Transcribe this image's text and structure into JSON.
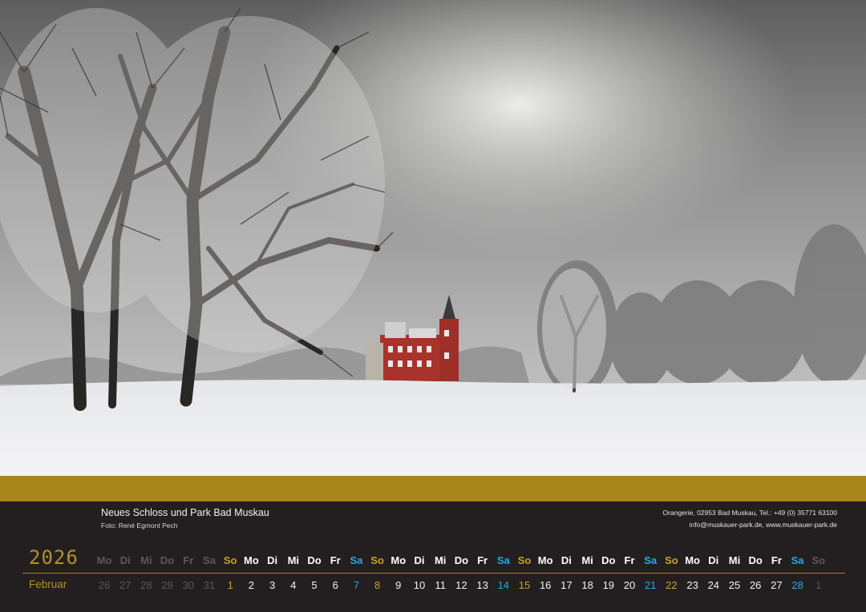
{
  "caption": {
    "title": "Neues Schloss und Park Bad Muskau",
    "credit": "Foto: René Egmont Pech"
  },
  "contact": {
    "line1": "Orangerie, 02953 Bad Muskau, Tel.: +49 (0) 35771 63100",
    "line2": "info@muskauer-park.de, www.muskauer-park.de"
  },
  "calendar": {
    "year": "2026",
    "month": "Februar",
    "weekdays": [
      "Mo",
      "Di",
      "Mi",
      "Do",
      "Fr",
      "Sa",
      "So",
      "Mo",
      "Di",
      "Mi",
      "Do",
      "Fr",
      "Sa",
      "So",
      "Mo",
      "Di",
      "Mi",
      "Do",
      "Fr",
      "Sa",
      "So",
      "Mo",
      "Di",
      "Mi",
      "Do",
      "Fr",
      "Sa",
      "So",
      "Mo",
      "Di",
      "Mi",
      "Do",
      "Fr",
      "Sa",
      "So"
    ],
    "dates": [
      "26",
      "27",
      "28",
      "29",
      "30",
      "31",
      "1",
      "2",
      "3",
      "4",
      "5",
      "6",
      "7",
      "8",
      "9",
      "10",
      "11",
      "12",
      "13",
      "14",
      "15",
      "16",
      "17",
      "18",
      "19",
      "20",
      "21",
      "22",
      "23",
      "24",
      "25",
      "26",
      "27",
      "28",
      "1"
    ],
    "styles": [
      "mute",
      "mute",
      "mute",
      "mute",
      "mute",
      "mute",
      "gold",
      "white",
      "white",
      "white",
      "white",
      "white",
      "blue",
      "gold",
      "white",
      "white",
      "white",
      "white",
      "white",
      "blue",
      "gold",
      "white",
      "white",
      "white",
      "white",
      "white",
      "blue",
      "gold",
      "white",
      "white",
      "white",
      "white",
      "white",
      "blue",
      "mute"
    ]
  },
  "colors": {
    "gold": "#a8861c",
    "saturday_blue": "#29a9df",
    "sunday_gold": "#c8a32a",
    "footer_bg": "#231e1f"
  }
}
